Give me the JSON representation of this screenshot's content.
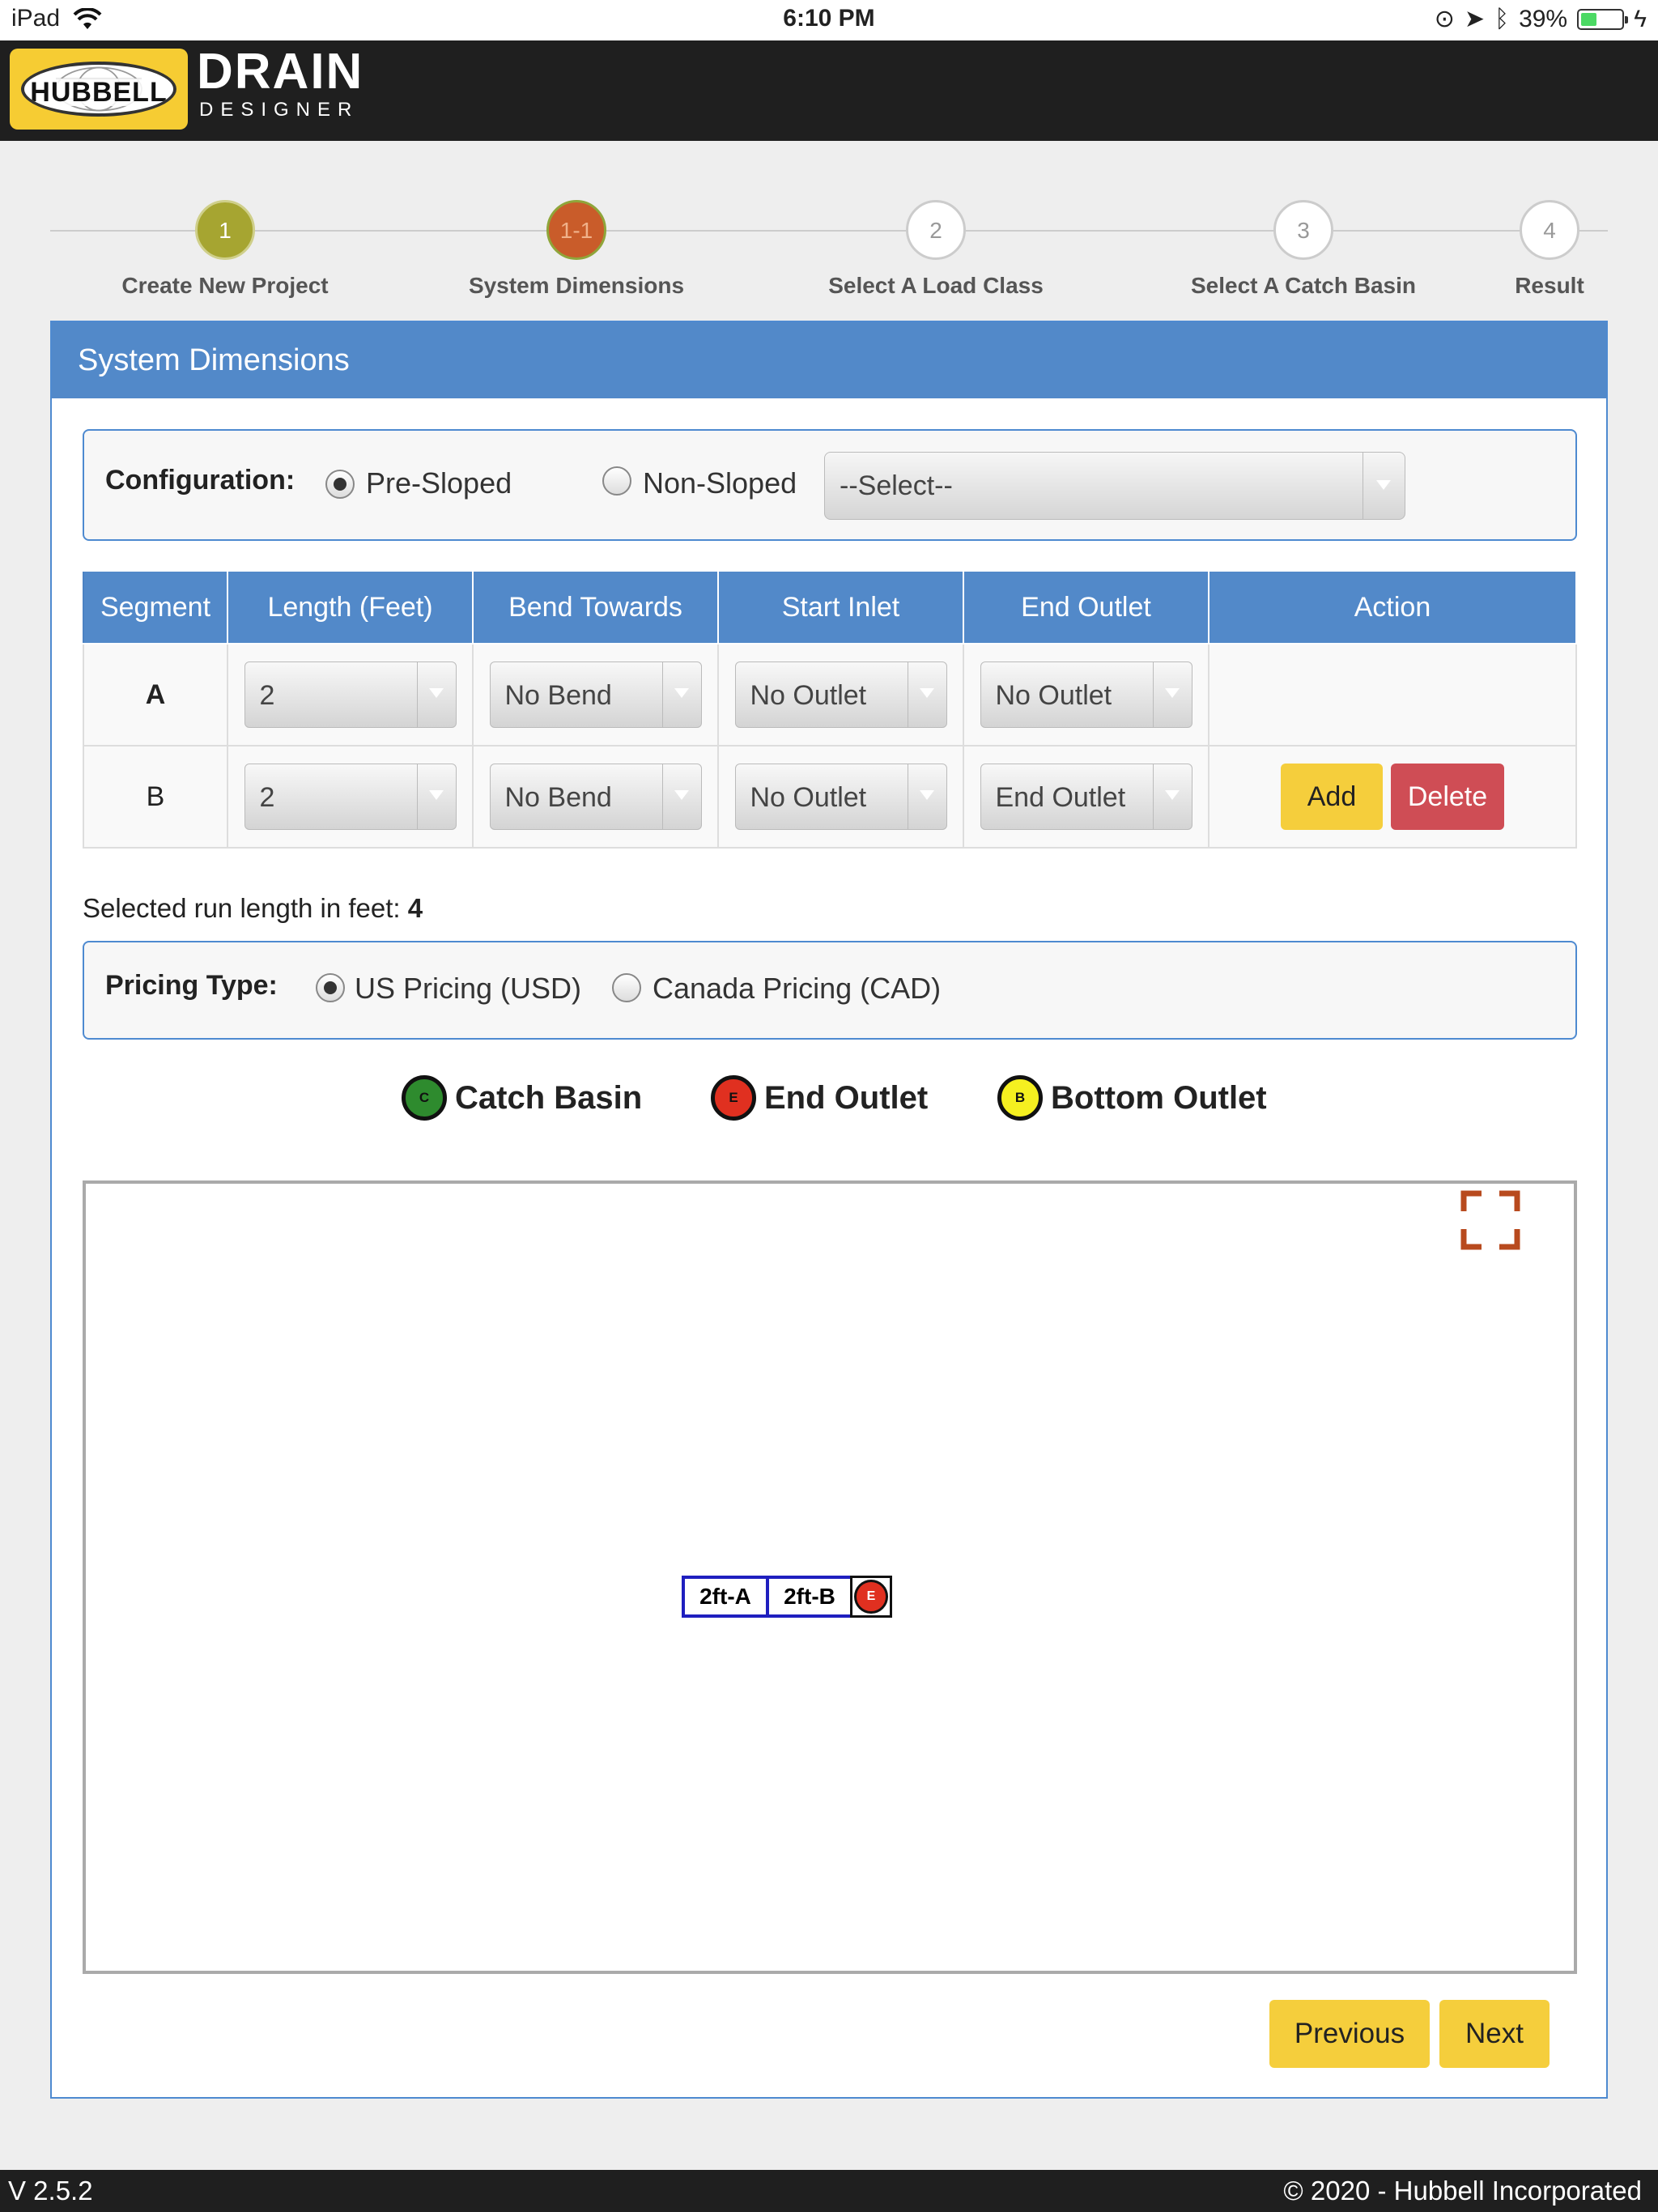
{
  "status_bar": {
    "device": "iPad",
    "time": "6:10 PM",
    "battery": "39%",
    "battery_level": 0.39
  },
  "header": {
    "logo_text": "HUBBELL",
    "brand_line1": "DRAIN",
    "brand_line2": "DESIGNER"
  },
  "steps": [
    {
      "number": "1",
      "label": "Create New Project",
      "state": "done"
    },
    {
      "number": "1-1",
      "label": "System Dimensions",
      "state": "active"
    },
    {
      "number": "2",
      "label": "Select A Load Class",
      "state": "pending"
    },
    {
      "number": "3",
      "label": "Select A Catch Basin",
      "state": "pending"
    },
    {
      "number": "4",
      "label": "Result",
      "state": "pending"
    }
  ],
  "panel": {
    "title": "System Dimensions"
  },
  "configuration": {
    "label": "Configuration:",
    "options": [
      {
        "label": "Pre-Sloped",
        "checked": true
      },
      {
        "label": "Non-Sloped",
        "checked": false
      }
    ],
    "select_value": "--Select--"
  },
  "table": {
    "headers": [
      "Segment",
      "Length (Feet)",
      "Bend Towards",
      "Start Inlet",
      "End Outlet",
      "Action"
    ],
    "rows": [
      {
        "segment": "A",
        "length": "2",
        "bend": "No Bend",
        "start_inlet": "No Outlet",
        "end_outlet": "No Outlet"
      },
      {
        "segment": "B",
        "length": "2",
        "bend": "No Bend",
        "start_inlet": "No Outlet",
        "end_outlet": "End Outlet"
      }
    ],
    "add_label": "Add",
    "delete_label": "Delete"
  },
  "run_length": {
    "label": "Selected run length in feet:",
    "value": "4"
  },
  "pricing": {
    "label": "Pricing Type:",
    "options": [
      {
        "label": "US Pricing (USD)",
        "checked": true
      },
      {
        "label": "Canada Pricing (CAD)",
        "checked": false
      }
    ]
  },
  "legend": [
    {
      "letter": "C",
      "label": "Catch Basin",
      "color": "#2e8b2e"
    },
    {
      "letter": "E",
      "label": "End Outlet",
      "color": "#e03020"
    },
    {
      "letter": "B",
      "label": "Bottom Outlet",
      "color": "#f5f020"
    }
  ],
  "diagram": {
    "segments": [
      "2ft-A",
      "2ft-B"
    ],
    "end_marker": "E"
  },
  "nav": {
    "previous": "Previous",
    "next": "Next"
  },
  "footer": {
    "version": "V 2.5.2",
    "copyright": "© 2020 - Hubbell Incorporated"
  },
  "colors": {
    "accent_blue": "#5289c9",
    "step_done": "#a6a531",
    "step_active": "#c95c2a",
    "button_yellow": "#f5ce3c",
    "button_red": "#cf4d55",
    "header_dark": "#1f1f1f"
  }
}
